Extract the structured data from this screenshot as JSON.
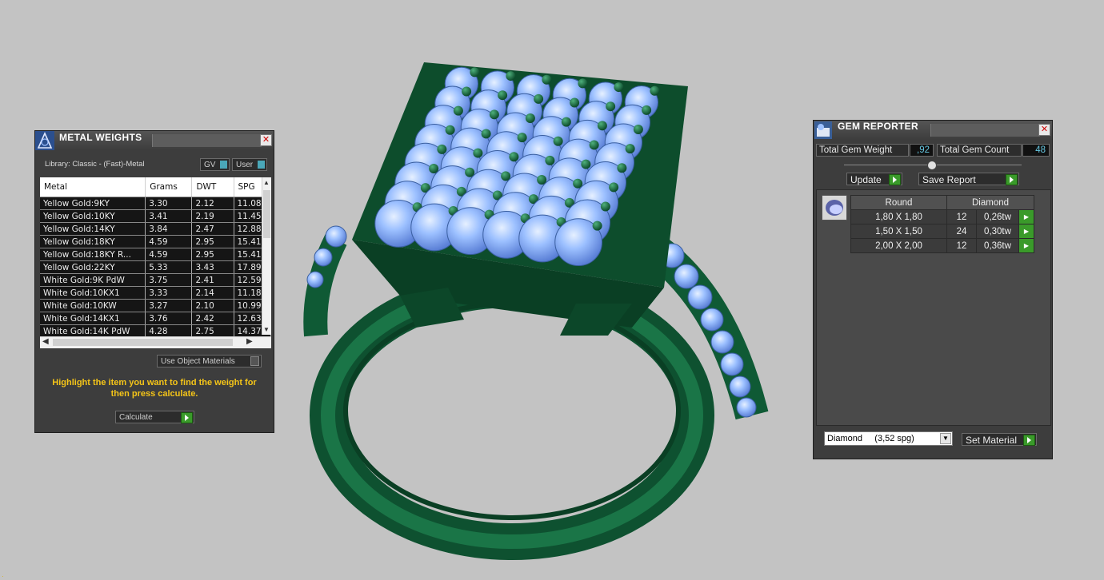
{
  "metal_weights": {
    "title": "METAL WEIGHTS",
    "library_label": "Library: Classic - (Fast)-Metal",
    "gv_label": "GV",
    "user_label": "User",
    "columns": [
      "Metal",
      "Grams",
      "DWT",
      "SPG"
    ],
    "rows": [
      [
        "Yellow Gold:9KY",
        "3.30",
        "2.12",
        "11.08"
      ],
      [
        "Yellow Gold:10KY",
        "3.41",
        "2.19",
        "11.45"
      ],
      [
        "Yellow Gold:14KY",
        "3.84",
        "2.47",
        "12.88"
      ],
      [
        "Yellow Gold:18KY",
        "4.59",
        "2.95",
        "15.41"
      ],
      [
        "Yellow Gold:18KY R...",
        "4.59",
        "2.95",
        "15.41"
      ],
      [
        "Yellow Gold:22KY",
        "5.33",
        "3.43",
        "17.89"
      ],
      [
        "White Gold:9K PdW",
        "3.75",
        "2.41",
        "12.59"
      ],
      [
        "White Gold:10KX1",
        "3.33",
        "2.14",
        "11.18"
      ],
      [
        "White Gold:10KW",
        "3.27",
        "2.10",
        "10.99"
      ],
      [
        "White Gold:14KX1",
        "3.76",
        "2.42",
        "12.63"
      ],
      [
        "White Gold:14K PdW",
        "4.28",
        "2.75",
        "14.37"
      ]
    ],
    "use_object_materials": "Use Object Materials",
    "hint": "Highlight the item you want to find the weight for then press calculate.",
    "calculate_label": "Calculate"
  },
  "gem_reporter": {
    "title": "GEM REPORTER",
    "total_weight_label": "Total Gem Weight",
    "total_weight_value": ",92",
    "total_count_label": "Total Gem Count",
    "total_count_value": "48",
    "update_label": "Update",
    "save_report_label": "Save Report",
    "shape_header": "Round",
    "material_header": "Diamond",
    "rows": [
      [
        "1,80 X 1,80",
        "12",
        "0,26tw"
      ],
      [
        "1,50 X 1,50",
        "24",
        "0,30tw"
      ],
      [
        "2,00 X 2,00",
        "12",
        "0,36tw"
      ]
    ],
    "material_select": "Diamond     (3,52 spg)",
    "set_material_label": "Set Material"
  },
  "colors": {
    "ring_green": "#14603a",
    "gem_blue": "#8fb8ff",
    "hint_yellow": "#f5c518"
  }
}
